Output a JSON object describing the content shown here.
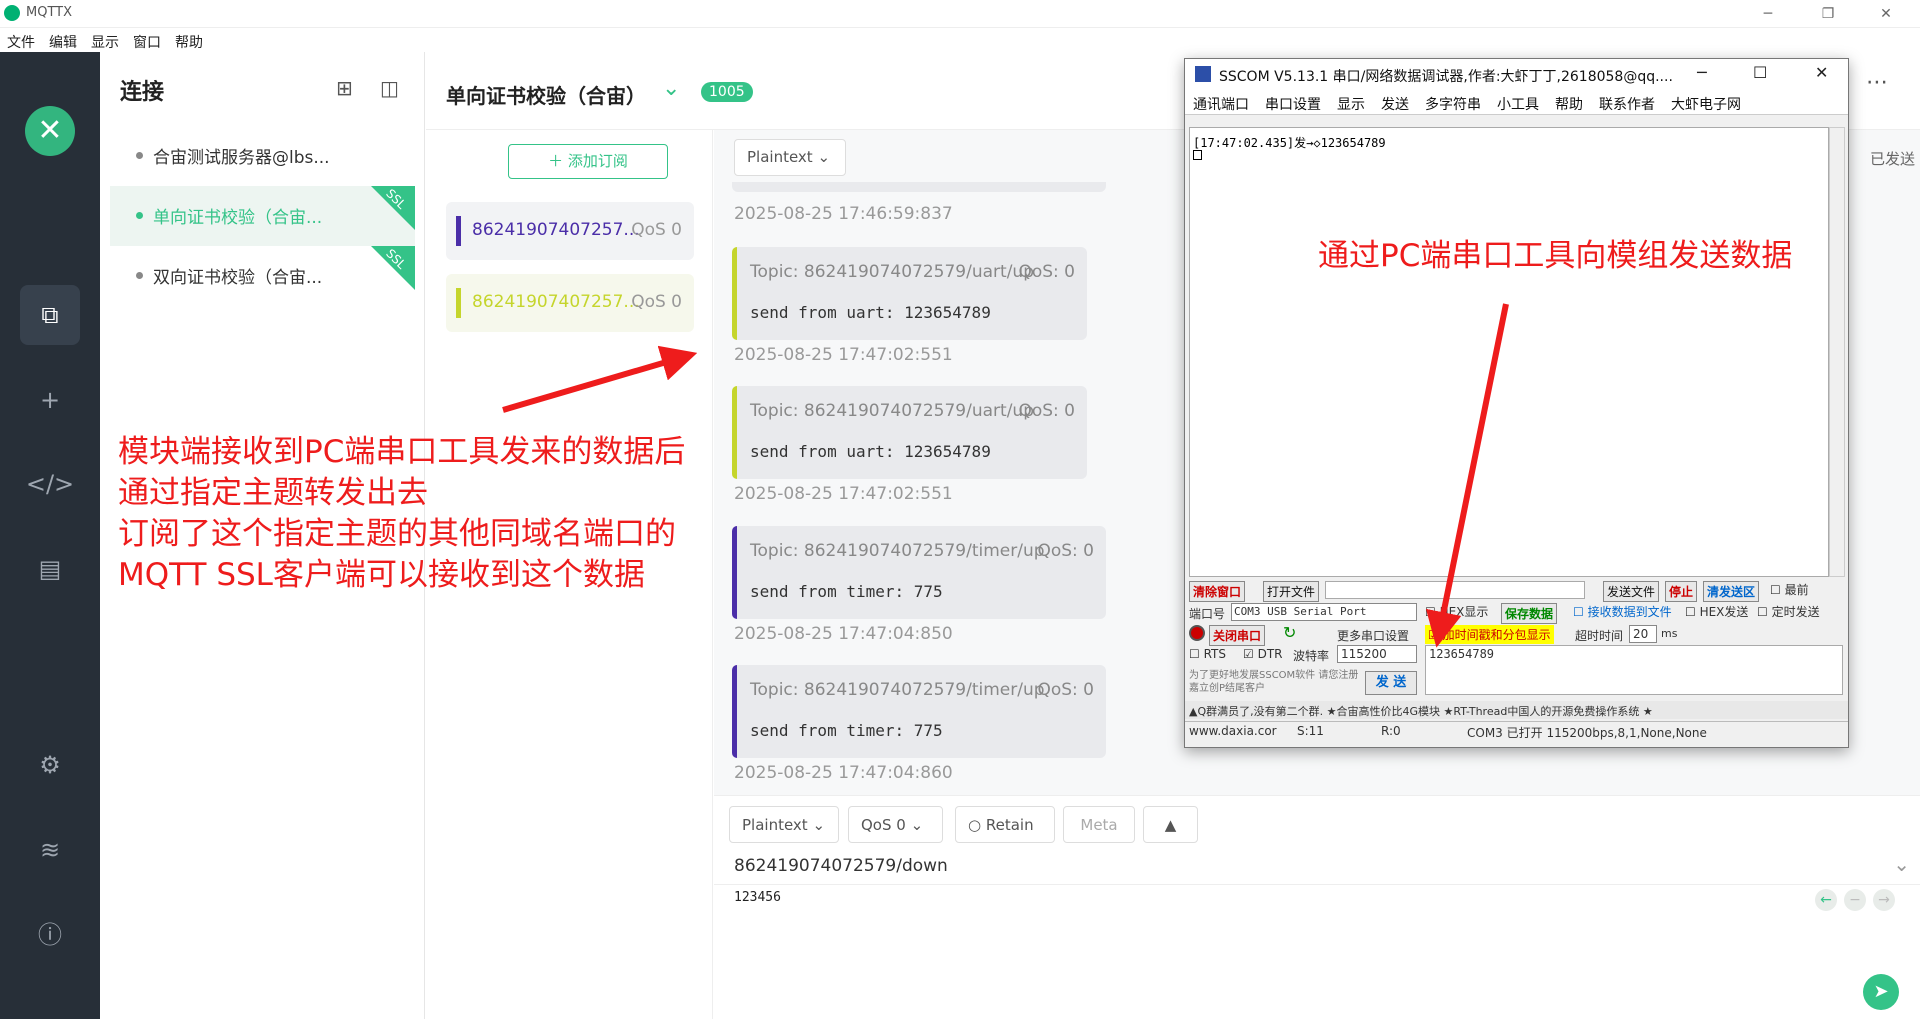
{
  "window": {
    "title": "MQTTX"
  },
  "menu": [
    "文件",
    "编辑",
    "显示",
    "窗口",
    "帮助"
  ],
  "connections": {
    "header": "连接",
    "items": [
      {
        "name": "合宙测试服务器@lbs...",
        "ssl": ""
      },
      {
        "name": "单向证书校验（合宙...",
        "ssl": "SSL"
      },
      {
        "name": "双向证书校验（合宙...",
        "ssl": "SSL"
      }
    ]
  },
  "active_connection": {
    "title": "单向证书校验（合宙）",
    "message_count": "1005"
  },
  "subscriptions": {
    "add_label": "添加订阅",
    "items": [
      {
        "topic": "86241907407257...",
        "qos": "QoS 0",
        "color": "#4b2ea8"
      },
      {
        "topic": "86241907407257...",
        "qos": "QoS 0",
        "color": "#c5d52c"
      }
    ]
  },
  "messages": {
    "format": "Plaintext",
    "sent_label": "已发送",
    "first_timestamp": "2025-08-25 17:46:59:837",
    "items": [
      {
        "topic": "Topic: 862419074072579/uart/up",
        "qos": "QoS: 0",
        "payload": "send from uart: 123654789",
        "time": "2025-08-25 17:47:02:551",
        "color": "#c5d52c"
      },
      {
        "topic": "Topic: 862419074072579/uart/up",
        "qos": "QoS: 0",
        "payload": "send from uart: 123654789",
        "time": "2025-08-25 17:47:02:551",
        "color": "#c5d52c"
      },
      {
        "topic": "Topic: 862419074072579/timer/up",
        "qos": "QoS: 0",
        "payload": "send from timer: 775",
        "time": "2025-08-25 17:47:04:850",
        "color": "#4b2ea8"
      },
      {
        "topic": "Topic: 862419074072579/timer/up",
        "qos": "QoS: 0",
        "payload": "send from timer: 775",
        "time": "2025-08-25 17:47:04:860",
        "color": "#4b2ea8"
      }
    ]
  },
  "publish": {
    "format": "Plaintext",
    "qos": "QoS 0",
    "retain": "Retain",
    "meta": "Meta",
    "topic": "862419074072579/down",
    "payload": "123456"
  },
  "sscom": {
    "title": "SSCOM V5.13.1 串口/网络数据调试器,作者:大虾丁丁,2618058@qq....",
    "menu": [
      "通讯端口",
      "串口设置",
      "显示",
      "发送",
      "多字符串",
      "小工具",
      "帮助",
      "联系作者",
      "大虾电子网"
    ],
    "rx_line": "[17:47:02.435]发→◇123654789",
    "clear_btn": "清除窗口",
    "open_file_btn": "打开文件",
    "send_file_btn": "发送文件",
    "stop_btn": "停止",
    "clear_send_btn": "清发送区",
    "topmost": "最前",
    "port_label": "端口号",
    "port_value": "COM3 USB Serial Port",
    "hex_display": "HEX显示",
    "save_data": "保存数据",
    "recv_to_file": "接收数据到文件",
    "hex_send": "HEX发送",
    "timed_send": "定时发送",
    "close_port_btn": "关闭串口",
    "more_settings": "更多串口设置",
    "add_timestamp": "加时间戳和分包显示",
    "timeout_label": "超时时间",
    "timeout_value": "20",
    "ms_label": "ms",
    "rts": "RTS",
    "dtr": "DTR",
    "baud_label": "波特率",
    "baud_value": "115200",
    "send_text": "123654789",
    "send_btn": "发 送",
    "promo": "为了更好地发展SSCOM软件 请您注册嘉立创P结尾客户",
    "ticker": "▲Q群满员了,没有第二个群.   ★合宙高性价比4G模块   ★RT-Thread中国人的开源免费操作系统   ★",
    "status": [
      "www.daxia.cor",
      "S:11",
      "R:0",
      "COM3 已打开  115200bps,8,1,None,None"
    ]
  },
  "annotations": {
    "right": "通过PC端串口工具向模组发送数据",
    "left_lines": [
      "模块端接收到PC端串口工具发来的数据后",
      "通过指定主题转发出去",
      "订阅了这个指定主题的其他同域名端口的",
      "MQTT SSL客户端可以接收到这个数据"
    ],
    "arrow_color": "#ee1c1c"
  }
}
